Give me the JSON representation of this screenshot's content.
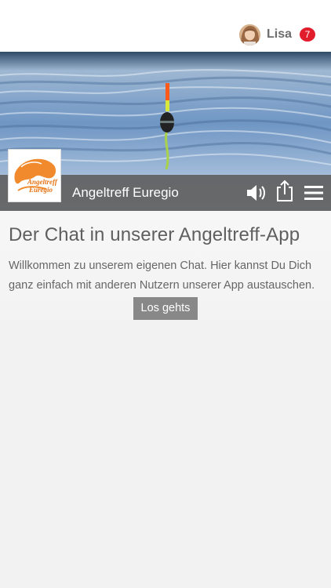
{
  "header": {
    "user_name": "Lisa",
    "notification_count": "7"
  },
  "app": {
    "brand_name": "Angeltreff Euregio",
    "logo_text_line1": "Angeltreff",
    "logo_text_line2": "Euregio"
  },
  "icons": {
    "sound": "speaker-icon",
    "share": "share-icon",
    "menu": "hamburger-menu-icon"
  },
  "main": {
    "title": "Der Chat in unserer Angeltreff-App",
    "description": "Willkommen zu unserem eigenen Chat. Hier kannst Du Dich ganz einfach mit anderen Nutzern unserer App austauschen.",
    "button_label": "Los gehts"
  },
  "colors": {
    "badge": "#e21d2b",
    "logo_orange": "#f08a2c",
    "button": "#888888"
  }
}
